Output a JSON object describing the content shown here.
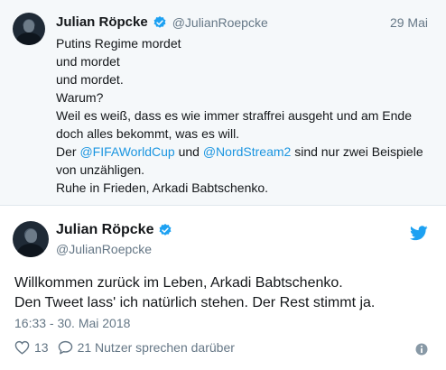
{
  "quoted_tweet": {
    "author_name": "Julian Röpcke",
    "handle": "@JulianRoepcke",
    "date": "29 Mai",
    "lines": [
      [
        {
          "text": "Putins Regime mordet"
        }
      ],
      [
        {
          "text": "und mordet"
        }
      ],
      [
        {
          "text": "und mordet."
        }
      ],
      [
        {
          "text": "Warum?"
        }
      ],
      [
        {
          "text": "Weil es weiß, dass es wie immer straffrei ausgeht und am Ende"
        }
      ],
      [
        {
          "text": "doch alles bekommt, was es will."
        }
      ],
      [
        {
          "text": "Der "
        },
        {
          "text": "@FIFAWorldCup",
          "mention": true
        },
        {
          "text": " und "
        },
        {
          "text": "@NordStream2",
          "mention": true
        },
        {
          "text": " sind nur zwei Beispiele"
        }
      ],
      [
        {
          "text": "von unzähligen."
        }
      ],
      [
        {
          "text": "Ruhe in Frieden, Arkadi Babtschenko."
        }
      ]
    ]
  },
  "main_tweet": {
    "author_name": "Julian Röpcke",
    "handle": "@JulianRoepcke",
    "text_lines": [
      "Willkommen zurück im Leben, Arkadi Babtschenko.",
      "Den Tweet lass' ich natürlich stehen. Der Rest stimmt ja."
    ],
    "timestamp": "16:33 - 30. Mai 2018",
    "likes": "13",
    "replies_label": "21 Nutzer sprechen darüber"
  },
  "icons": {
    "verified": "verified-badge-icon",
    "twitter": "twitter-bird-icon",
    "like": "heart-icon",
    "reply": "speech-bubble-icon",
    "info": "info-icon"
  },
  "colors": {
    "link": "#1b95e0",
    "muted": "#657786",
    "verified": "#1da1f2",
    "quoted_bg": "#f5f8fa"
  }
}
